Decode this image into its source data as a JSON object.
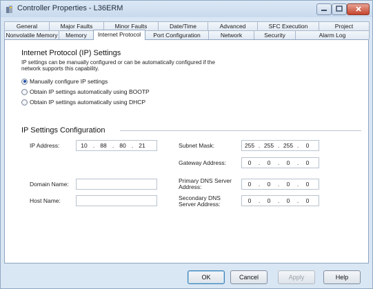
{
  "window": {
    "title": "Controller Properties - L36ERM"
  },
  "tabs": {
    "row1": [
      "General",
      "Major Faults",
      "Minor Faults",
      "Date/Time",
      "Advanced",
      "SFC Execution",
      "Project"
    ],
    "row2": [
      "Nonvolatile Memory",
      "Memory",
      "Internet Protocol",
      "Port Configuration",
      "Network",
      "Security",
      "Alarm Log"
    ],
    "active": "Internet Protocol"
  },
  "ip_settings": {
    "heading": "Internet Protocol (IP) Settings",
    "description": "IP settings can be manually configured or can be automatically configured if the network supports this capability.",
    "options": [
      {
        "label": "Manually configure IP settings",
        "checked": true
      },
      {
        "label": "Obtain IP settings automatically using BOOTP",
        "checked": false
      },
      {
        "label": "Obtain IP settings automatically using DHCP",
        "checked": false
      }
    ]
  },
  "ip_config": {
    "heading": "IP Settings Configuration",
    "ip_address": {
      "label": "IP Address:",
      "octets": [
        "10",
        "88",
        "80",
        "21"
      ]
    },
    "subnet_mask": {
      "label": "Subnet Mask:",
      "octets": [
        "255",
        "255",
        "255",
        "0"
      ]
    },
    "gateway": {
      "label": "Gateway Address:",
      "octets": [
        "0",
        "0",
        "0",
        "0"
      ]
    },
    "primary_dns": {
      "label": "Primary DNS Server Address:",
      "octets": [
        "0",
        "0",
        "0",
        "0"
      ]
    },
    "secondary_dns": {
      "label": "Secondary DNS Server Address:",
      "octets": [
        "0",
        "0",
        "0",
        "0"
      ]
    },
    "domain_name": {
      "label": "Domain Name:",
      "value": ""
    },
    "host_name": {
      "label": "Host Name:",
      "value": ""
    }
  },
  "buttons": {
    "ok": "OK",
    "cancel": "Cancel",
    "apply": "Apply",
    "help": "Help"
  },
  "colors": {
    "accent": "#1f4fa8",
    "close_button": "#c4442c"
  }
}
